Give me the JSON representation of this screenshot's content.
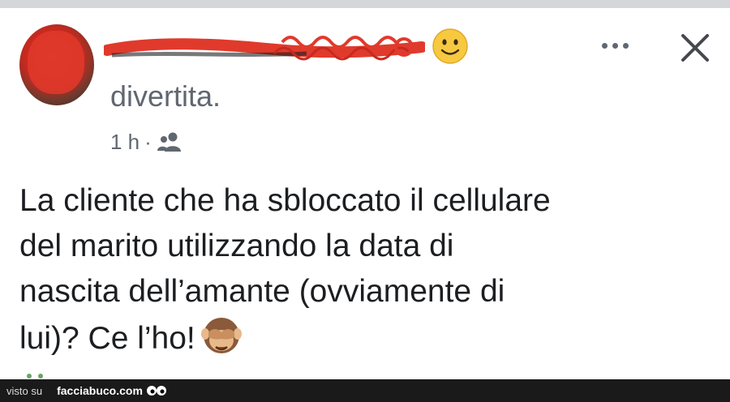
{
  "post": {
    "activity_text": "divertita.",
    "timestamp": "1 h",
    "separator": "·",
    "audience_icon": "friends-icon",
    "body_lines": [
      "La cliente che ha sbloccato il cellulare",
      "del marito utilizzando la data di",
      "nascita dell’amante (ovviamente di",
      "lui)? Ce l’ho!"
    ],
    "feeling_emoji": "smiling-face-emoji",
    "body_emoji": "see-no-evil-monkey-emoji"
  },
  "header": {
    "more_icon": "more-options-icon",
    "close_icon": "close-icon"
  },
  "watermark": {
    "prefix": "visto su",
    "site": "facciabuco.com"
  },
  "colors": {
    "text_primary": "#1c1e21",
    "text_secondary": "#606770",
    "redaction": "#e03a2c",
    "footer_bg": "#1a1a1a"
  }
}
